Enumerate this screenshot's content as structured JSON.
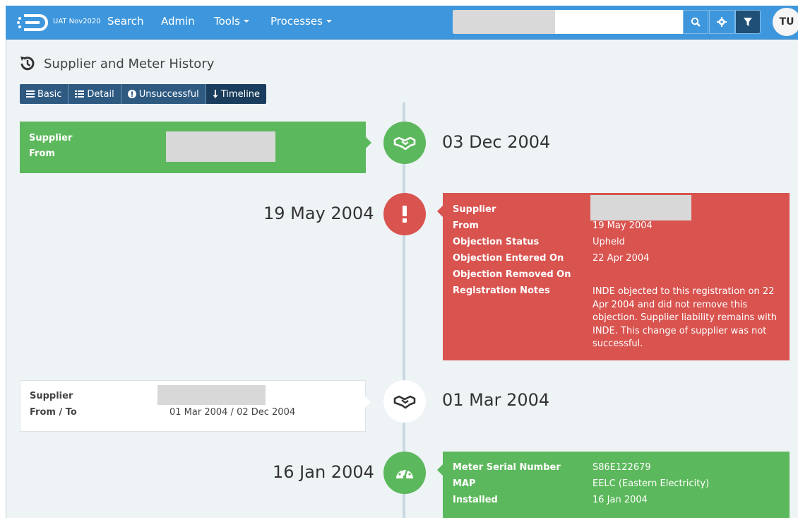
{
  "nav": {
    "env_label": "UAT Nov2020",
    "search": "Search",
    "admin": "Admin",
    "tools": "Tools",
    "processes": "Processes",
    "avatar_initials": "TU"
  },
  "page": {
    "title": "Supplier and Meter History",
    "views": [
      {
        "label": "Basic",
        "icon": "list-icon"
      },
      {
        "label": "Detail",
        "icon": "table-icon"
      },
      {
        "label": "Unsuccessful",
        "icon": "exclamation-circle-icon"
      },
      {
        "label": "Timeline",
        "icon": "arrow-down-icon",
        "active": true
      }
    ]
  },
  "timeline": [
    {
      "date": "03 Dec 2004",
      "icon": "handshake-icon",
      "color": "#5cb85c",
      "rows": [
        {
          "label": "Supplier",
          "value": ""
        },
        {
          "label": "From",
          "value": ""
        }
      ]
    },
    {
      "date": "19 May 2004",
      "icon": "exclamation-icon",
      "color": "#d9534f",
      "rows": [
        {
          "label": "Supplier",
          "value": ""
        },
        {
          "label": "From",
          "value": "19 May 2004"
        },
        {
          "label": "Objection Status",
          "value": "Upheld"
        },
        {
          "label": "Objection Entered On",
          "value": "22 Apr 2004"
        },
        {
          "label": "Objection Removed On",
          "value": ""
        },
        {
          "label": "Registration Notes",
          "value": "INDE objected to this registration on 22 Apr 2004 and did not remove this objection. Supplier liability remains with INDE. This change of supplier was not successful."
        }
      ]
    },
    {
      "date": "01 Mar 2004",
      "icon": "handshake-icon",
      "color": "#ffffff",
      "rows": [
        {
          "label": "Supplier",
          "value": ""
        },
        {
          "label": "From / To",
          "value": "01 Mar 2004 / 02 Dec 2004"
        }
      ]
    },
    {
      "date": "16 Jan 2004",
      "icon": "meter-gauge-icon",
      "color": "#5cb85c",
      "rows": [
        {
          "label": "Meter Serial Number",
          "value": "S86E122679"
        },
        {
          "label": "MAP",
          "value": "EELC (Eastern Electricity)"
        },
        {
          "label": "Installed",
          "value": "16 Jan 2004"
        }
      ]
    }
  ]
}
